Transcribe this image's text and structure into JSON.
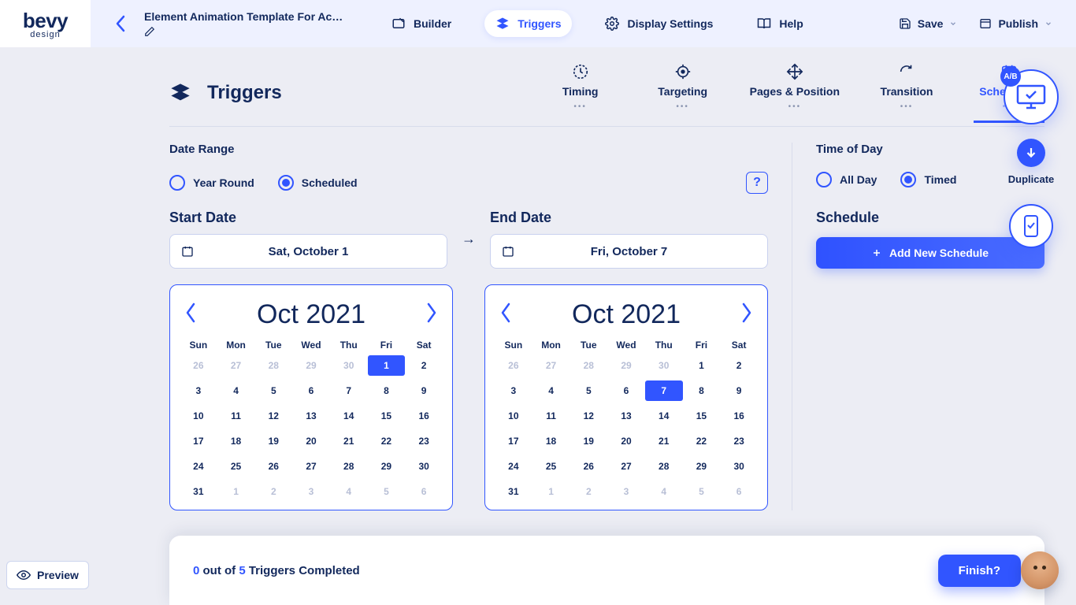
{
  "logo": {
    "main": "bevy",
    "sub": "design"
  },
  "page_title": "Element Animation Template For Acade...",
  "top_tabs": {
    "builder": "Builder",
    "triggers": "Triggers",
    "display_settings": "Display Settings",
    "help": "Help"
  },
  "top_actions": {
    "save": "Save",
    "publish": "Publish"
  },
  "section_title": "Triggers",
  "trigger_tabs": {
    "timing": "Timing",
    "targeting": "Targeting",
    "pages_position": "Pages & Position",
    "transition": "Transition",
    "scheduling": "Scheduling"
  },
  "date_range": {
    "heading": "Date Range",
    "year_round": "Year Round",
    "scheduled": "Scheduled",
    "help": "?"
  },
  "start": {
    "label": "Start Date",
    "value": "Sat, October 1"
  },
  "end": {
    "label": "End Date",
    "value": "Fri, October 7"
  },
  "calendar": {
    "month_label": "Oct 2021",
    "dow": [
      "Sun",
      "Mon",
      "Tue",
      "Wed",
      "Thu",
      "Fri",
      "Sat"
    ],
    "start_selected": "1",
    "end_selected": "7",
    "prev_trail": [
      "26",
      "27",
      "28",
      "29",
      "30"
    ],
    "days": [
      "1",
      "2",
      "3",
      "4",
      "5",
      "6",
      "7",
      "8",
      "9",
      "10",
      "11",
      "12",
      "13",
      "14",
      "15",
      "16",
      "17",
      "18",
      "19",
      "20",
      "21",
      "22",
      "23",
      "24",
      "25",
      "26",
      "27",
      "28",
      "29",
      "30",
      "31"
    ],
    "next_trail": [
      "1",
      "2",
      "3",
      "4",
      "5",
      "6"
    ]
  },
  "time_of_day": {
    "heading": "Time of Day",
    "all_day": "All Day",
    "timed": "Timed"
  },
  "schedule": {
    "heading": "Schedule",
    "add_btn": "Add New Schedule"
  },
  "footer": {
    "completed": "0",
    "total": "5",
    "text_mid": " out of ",
    "text_end": " Triggers Completed",
    "finish": "Finish?"
  },
  "rail": {
    "ab": "A/B",
    "duplicate": "Duplicate"
  },
  "preview": "Preview"
}
